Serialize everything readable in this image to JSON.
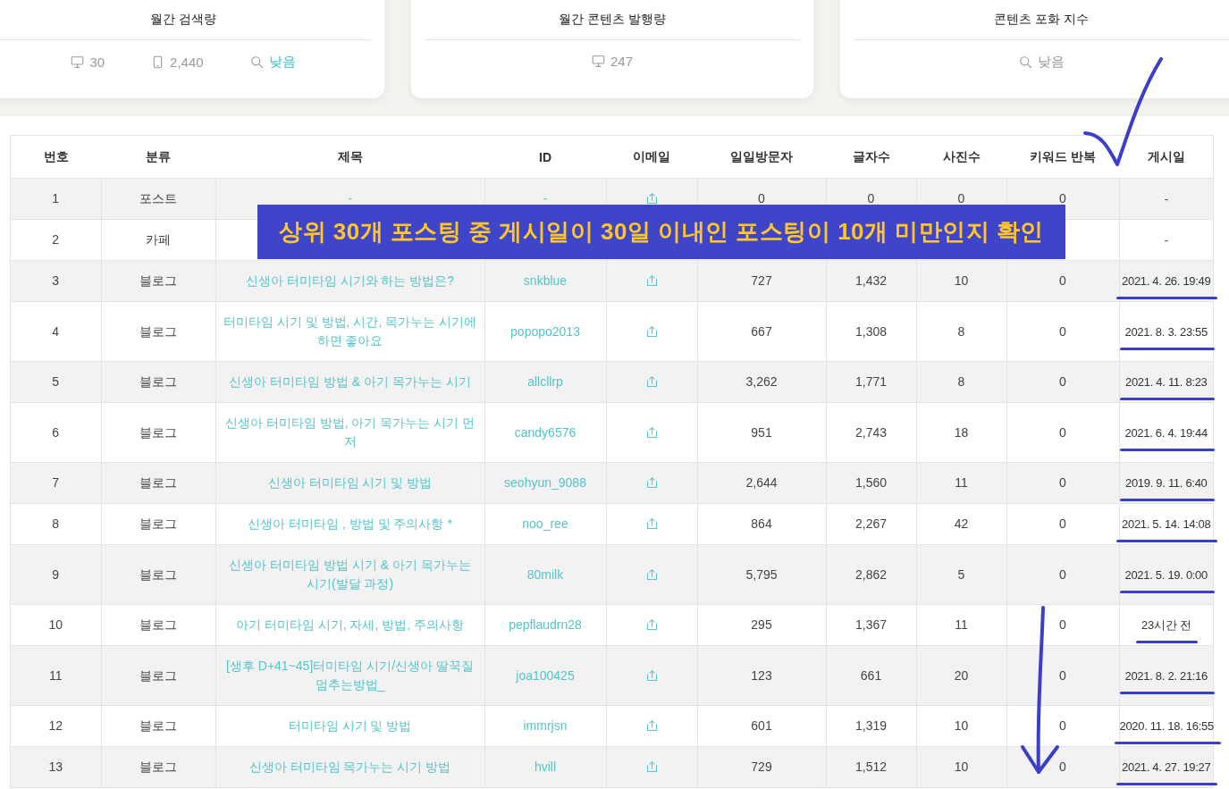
{
  "summary_cards": [
    {
      "title": "월간 검색량",
      "stats": [
        {
          "kind": "pc",
          "value": "30",
          "accent": false
        },
        {
          "kind": "mobile",
          "value": "2,440",
          "accent": false
        },
        {
          "kind": "search",
          "value": "낮음",
          "accent": true
        }
      ]
    },
    {
      "title": "월간 콘텐츠 발행량",
      "stats": [
        {
          "kind": "pc",
          "value": "247",
          "accent": false
        }
      ]
    },
    {
      "title": "콘텐츠 포화 지수",
      "stats": [
        {
          "kind": "search",
          "value": "낮음",
          "accent": false
        }
      ]
    }
  ],
  "table": {
    "columns": [
      "번호",
      "분류",
      "제목",
      "ID",
      "이메일",
      "일일방문자",
      "글자수",
      "사진수",
      "키워드 반복",
      "게시일"
    ],
    "rows": [
      {
        "no": "1",
        "category": "포스트",
        "title": "-",
        "id": "-",
        "email_link": true,
        "visitors": "0",
        "chars": "0",
        "photos": "0",
        "keyword_repeat": "0",
        "posted": "-",
        "underlined": false
      },
      {
        "no": "2",
        "category": "카페",
        "email_link": false,
        "posted": "-",
        "underlined": false
      },
      {
        "no": "3",
        "category": "블로그",
        "title": "신생아 터미타임 시기와 하는 방법은?",
        "id": "snkblue",
        "email_link": true,
        "visitors": "727",
        "chars": "1,432",
        "photos": "10",
        "keyword_repeat": "0",
        "posted": "2021. 4. 26. 19:49",
        "underlined": true
      },
      {
        "no": "4",
        "category": "블로그",
        "title": "터미타임 시기 및 방법, 시간, 목가누는 시기에 하면 좋아요",
        "id": "popopo2013",
        "email_link": true,
        "visitors": "667",
        "chars": "1,308",
        "photos": "8",
        "keyword_repeat": "0",
        "posted": "2021. 8. 3. 23:55",
        "underlined": true
      },
      {
        "no": "5",
        "category": "블로그",
        "title": "신생아 터미타임 방법 & 아기 목가누는 시기",
        "id": "allcllrp",
        "email_link": true,
        "visitors": "3,262",
        "chars": "1,771",
        "photos": "8",
        "keyword_repeat": "0",
        "posted": "2021. 4. 11. 8:23",
        "underlined": true
      },
      {
        "no": "6",
        "category": "블로그",
        "title": "신생아 터미타임 방법, 아기 목가누는 시기 먼저",
        "id": "candy6576",
        "email_link": true,
        "visitors": "951",
        "chars": "2,743",
        "photos": "18",
        "keyword_repeat": "0",
        "posted": "2021. 6. 4. 19:44",
        "underlined": true
      },
      {
        "no": "7",
        "category": "블로그",
        "title": "신생아 터미타임 시기 및 방법",
        "id": "seohyun_9088",
        "email_link": true,
        "visitors": "2,644",
        "chars": "1,560",
        "photos": "11",
        "keyword_repeat": "0",
        "posted": "2019. 9. 11. 6:40",
        "underlined": true
      },
      {
        "no": "8",
        "category": "블로그",
        "title": "신생아 터미타임 , 방법 및 주의사항 *",
        "id": "noo_ree",
        "email_link": true,
        "visitors": "864",
        "chars": "2,267",
        "photos": "42",
        "keyword_repeat": "0",
        "posted": "2021. 5. 14. 14:08",
        "underlined": true
      },
      {
        "no": "9",
        "category": "블로그",
        "title": "신생아 터미타임 방법 시기 & 아기 목가누는 시기(발달 과정)",
        "id": "80milk",
        "email_link": true,
        "visitors": "5,795",
        "chars": "2,862",
        "photos": "5",
        "keyword_repeat": "0",
        "posted": "2021. 5. 19. 0:00",
        "underlined": true
      },
      {
        "no": "10",
        "category": "블로그",
        "title": "아기 터미타임 시기, 자세, 방법, 주의사항",
        "id": "pepflaudrn28",
        "email_link": true,
        "visitors": "295",
        "chars": "1,367",
        "photos": "11",
        "keyword_repeat": "0",
        "posted": "23시간 전",
        "underlined": true
      },
      {
        "no": "11",
        "category": "블로그",
        "title": "[생후 D+41~45]터미타임 시기/신생아 딸꾹질 멈추는방법_",
        "id": "joa100425",
        "email_link": true,
        "visitors": "123",
        "chars": "661",
        "photos": "20",
        "keyword_repeat": "0",
        "posted": "2021. 8. 2. 21:16",
        "underlined": true
      },
      {
        "no": "12",
        "category": "블로그",
        "title": "터미타임 시기 및 방법",
        "id": "immrjsn",
        "email_link": true,
        "visitors": "601",
        "chars": "1,319",
        "photos": "10",
        "keyword_repeat": "0",
        "posted": "2020. 11. 18. 16:55",
        "underlined": true
      },
      {
        "no": "13",
        "category": "블로그",
        "title": "신생아 터미타임 목가누는 시기 방법",
        "id": "hvill",
        "email_link": true,
        "visitors": "729",
        "chars": "1,512",
        "photos": "10",
        "keyword_repeat": "0",
        "posted": "2021. 4. 27. 19:27",
        "underlined": true
      }
    ]
  },
  "banner": {
    "text": "상위 30개 포스팅 중 게시일이 30일 이내인 포스팅이 10개 미만인지 확인"
  }
}
